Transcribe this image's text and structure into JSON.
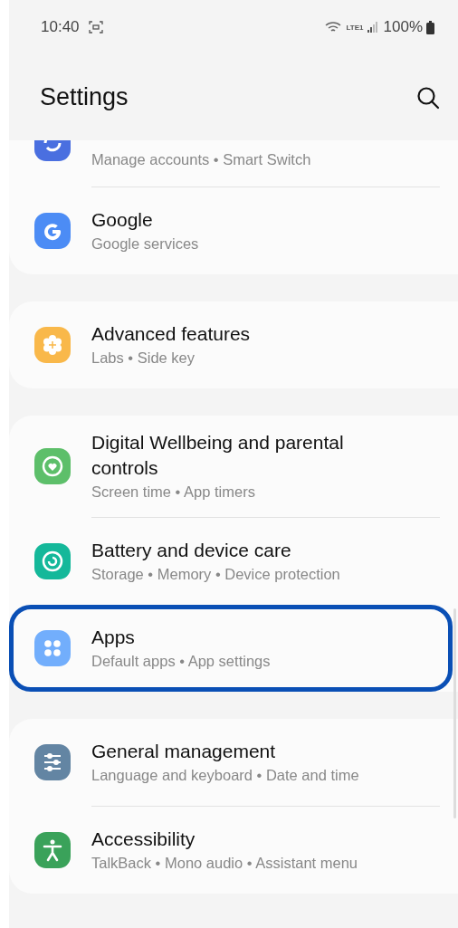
{
  "status_bar": {
    "time": "10:40",
    "network": "LTE1",
    "battery": "100%"
  },
  "header": {
    "title": "Settings"
  },
  "groups": [
    {
      "items": [
        {
          "color": "#4a6fe0",
          "subtitle": "Manage accounts • Smart Switch",
          "selected": false
        },
        {
          "color": "#4c8cf5",
          "title": "Google",
          "subtitle": "Google services",
          "selected": false
        }
      ]
    },
    {
      "items": [
        {
          "color": "#f9b84a",
          "title": "Advanced features",
          "subtitle": "Labs • Side key",
          "selected": false
        }
      ]
    },
    {
      "items": [
        {
          "color": "#5dbf6a",
          "title": "Digital Wellbeing and parental controls",
          "subtitle": "Screen time • App timers",
          "selected": false
        },
        {
          "color": "#14b89a",
          "title": "Battery and device care",
          "subtitle": "Storage • Memory • Device protection",
          "selected": false
        },
        {
          "color": "#72aefc",
          "title": "Apps",
          "subtitle": "Default apps • App settings",
          "selected": true
        }
      ]
    },
    {
      "items": [
        {
          "color": "#6385a3",
          "title": "General management",
          "subtitle": "Language and keyboard • Date and time",
          "selected": false
        },
        {
          "color": "#3aa25a",
          "title": "Accessibility",
          "subtitle": "TalkBack • Mono audio • Assistant menu",
          "selected": false
        }
      ]
    }
  ]
}
